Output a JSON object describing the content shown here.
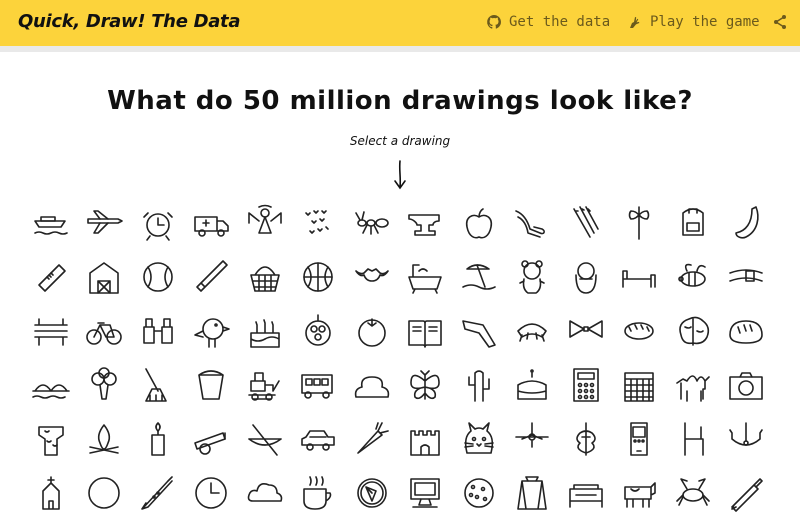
{
  "header": {
    "brand": "Quick, Draw! The Data",
    "links": [
      {
        "label": "Get the data",
        "icon": "github-icon"
      },
      {
        "label": "Play the game",
        "icon": "hand-drawing-icon"
      }
    ],
    "share_icon": "share-icon",
    "background": "#fcd33b"
  },
  "main": {
    "title": "What do 50 million drawings look like?",
    "hint": "Select a drawing"
  },
  "drawings": [
    "aircraft-carrier",
    "airplane",
    "alarm-clock",
    "ambulance",
    "angel",
    "animal-migration",
    "ant",
    "anvil",
    "apple",
    "arm",
    "asparagus",
    "axe",
    "backpack",
    "banana",
    "bandage",
    "barn",
    "baseball",
    "baseball-bat",
    "basket",
    "basketball",
    "bat",
    "bathtub",
    "beach",
    "bear",
    "beard",
    "bed",
    "bee",
    "belt",
    "bench",
    "bicycle",
    "binoculars",
    "bird",
    "birthday-cake",
    "blackberry",
    "blueberry",
    "book",
    "boomerang",
    "bottlecap",
    "bowtie",
    "bracelet",
    "brain",
    "bread",
    "bridge",
    "broccoli",
    "broom",
    "bucket",
    "bulldozer",
    "bus",
    "bush",
    "butterfly",
    "cactus",
    "cake",
    "calculator",
    "calendar",
    "camel",
    "camera",
    "camouflage",
    "campfire",
    "candle",
    "cannon",
    "canoe",
    "car",
    "carrot",
    "castle",
    "cat",
    "ceiling-fan",
    "cello",
    "cell-phone",
    "chair",
    "chandelier",
    "church",
    "circle",
    "clarinet",
    "clock",
    "cloud",
    "coffee-cup",
    "compass",
    "computer",
    "cookie",
    "cooler",
    "couch",
    "cow",
    "crab",
    "crayon"
  ]
}
